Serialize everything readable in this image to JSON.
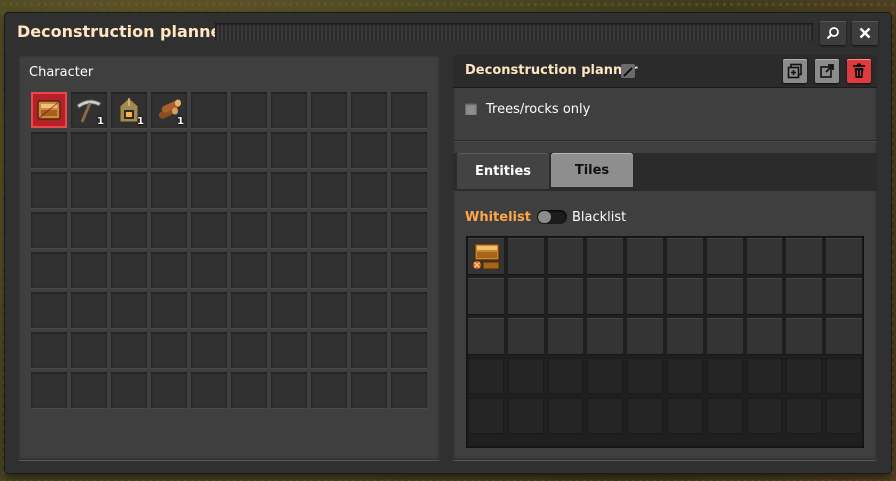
{
  "window": {
    "title": "Deconstruction planner"
  },
  "titlebar_buttons": {
    "search_icon": "search-icon",
    "close_icon": "close-icon"
  },
  "character": {
    "caption": "Character",
    "slots": [
      {
        "icon": "deconstruction-planner-icon",
        "count": "",
        "selected": true
      },
      {
        "icon": "pickaxe-icon",
        "count": "1"
      },
      {
        "icon": "burner-mining-drill-icon",
        "count": "1"
      },
      {
        "icon": "wood-icon",
        "count": "1"
      }
    ],
    "total_slots": 80
  },
  "planner": {
    "title": "Deconstruction planner",
    "trees_rocks_only": "Trees/rocks only",
    "tabs": [
      "Entities",
      "Tiles"
    ],
    "active_tab": "Entities",
    "whitelist_label": "Whitelist",
    "blacklist_label": "Blacklist",
    "filter_slots": [
      {
        "icon": "wooden-chest-icon"
      }
    ],
    "active_filter_slots": 30,
    "total_filter_slots": 50
  },
  "colors": {
    "accent_orange": "#ffa64a",
    "title_text": "#ffe6c0",
    "danger_red": "#e0393e"
  }
}
